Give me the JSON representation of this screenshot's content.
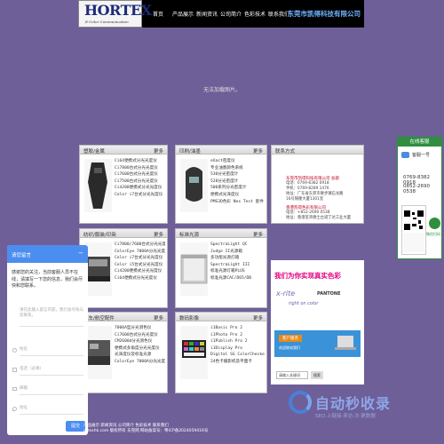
{
  "header": {
    "logo_brand": "HORTEX",
    "logo_sub": "E-Color Communication",
    "nav": [
      "首页",
      "产品展示",
      "新闻资讯",
      "公司简介",
      "色彩技术",
      "联系我们"
    ],
    "company": "东莞市凯得科技有限公司"
  },
  "banner_alt": "无法加载图片。",
  "panels": {
    "p1": {
      "title": "塑胶/金属",
      "more": "更多",
      "items": [
        "Ci64便携式分光光度仪",
        "Ci7800台式分光光度仪",
        "Ci7600台式分光光度仪",
        "Ci7500台式分光光度仪",
        "Ci4200便携式分光光度仪",
        "Color i7台式分光光度仪"
      ]
    },
    "p2": {
      "title": "印刷/油墨",
      "more": "更多",
      "items": [
        "eXact密度仪",
        "专业油墨颜色系统",
        "530分光密度计",
        "528分光密度计",
        "500系列分光密度计",
        "便携式光泽度仪",
        "PMS3D色彩 Nex Test 套件"
      ]
    },
    "p3": {
      "title": "纺织/服装/印染",
      "more": "更多",
      "items": [
        "Ci7800/7600台式分光光度仪",
        "ColorEye 7000A分光光度仪",
        "Color i7台式分光光度仪",
        "Color i5台式分光光度仪",
        "Ci4200便携式分光光度仪",
        "Ci64便携式分光光度仪"
      ]
    },
    "p4": {
      "title": "标准光源",
      "more": "更多",
      "items": [
        "SpectraLight QC",
        "Judge II光源箱",
        "多功能光源灯箱",
        "SpectraLight III",
        "标准光源灯箱PLUS",
        "标准光源CAC/D65/DB"
      ]
    },
    "p5": {
      "title": "汽车/航空配件",
      "more": "更多",
      "items": [
        "7000A型分光测色仪",
        "Ci7600台式分光光度仪",
        "CM2600d分光测色仪",
        "便携式多角度分光光度仪",
        "光泽度仪及标准光源",
        "ColorEye 7000A分光光度仪"
      ]
    },
    "p6": {
      "title": "数码影像",
      "more": "更多",
      "items": [
        "i1Basic Pro 2",
        "i1Photo Pro 2",
        "i1Publish Pro 2",
        "i1Display Pro",
        "Digital SG ColorChecker",
        "24色卡摄影机及平面卡"
      ]
    }
  },
  "contact": {
    "title": "联系方式",
    "co1": "东莞市凯得科技有限公司 总部",
    "tel1": "电话：0769-8382 0918",
    "tel1b": "手机：0769-8289 1476",
    "addr1": "地址：广东省东莞市寮步镇石龙路",
    "addr1b": "16号锦隆大厦1301室",
    "co2": "香港凯得色彩有限公司",
    "tel2": "电话：+852-2690 0538",
    "addr2": "地址：香港荃湾德士古道丁达工业大厦"
  },
  "ad": {
    "slogan": "我们为你实现真实色彩",
    "xrite": "x-rite",
    "pantone": "PANTONE",
    "right_on": "right on color",
    "service": "客户服务",
    "welcome": "欢迎致电我们",
    "login": "请输入关键词",
    "go": "搜索"
  },
  "qq": {
    "head": "在线客服",
    "contact": "客服一号",
    "phone1": "0769-8382 0918",
    "phone2": "0852-2690 0538",
    "qr_label": "微信扫码"
  },
  "chat": {
    "title": "请您留言",
    "intro": "感谢您的关注，当前客服人员不在线，请填写一下您的信息，我们会尽快和您联系。",
    "fields": [
      "请在此输入留言内容，我们会尽快与您联系。",
      "姓名",
      "电话（必填）",
      "邮箱",
      "地址"
    ],
    "submit": "提交"
  },
  "footer": {
    "line1": "产品展示  新闻资讯  公司简介  色彩技术  联系我们",
    "line2": "ortexhk.com  版权所有  东莞网  网站备案号：粤ICP备2024059416号"
  },
  "watermark": {
    "text": "自动秒收录",
    "sub": "SEO·上链接·来访·次·更数据"
  },
  "colors": {
    "background": "#6e5f99",
    "header": "#000000",
    "company": "#6fb4ff",
    "accent_red": "#c0001a",
    "chat_blue": "#4c8ef0",
    "qq_green": "#2f8f3f"
  }
}
